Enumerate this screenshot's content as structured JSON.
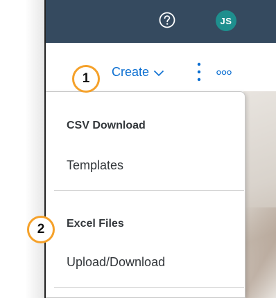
{
  "header": {
    "help_icon": "question-circle-icon",
    "avatar_initials": "JS",
    "avatar_color": "#1e8f8e",
    "bar_color": "#354a5f"
  },
  "toolbar": {
    "create_label": "Create",
    "create_icon": "chevron-down-icon",
    "vertical_more_icon": "vertical-ellipsis-icon",
    "horizontal_more_icon": "horizontal-ellipsis-icon",
    "accent_color": "#0a6ed1"
  },
  "menu": {
    "groups": [
      {
        "heading": "CSV Download",
        "items": [
          "Templates"
        ]
      },
      {
        "heading": "Excel Files",
        "items": [
          "Upload/Download"
        ]
      }
    ]
  },
  "callouts": [
    "1",
    "2"
  ],
  "callout_color": "#f5a12a"
}
